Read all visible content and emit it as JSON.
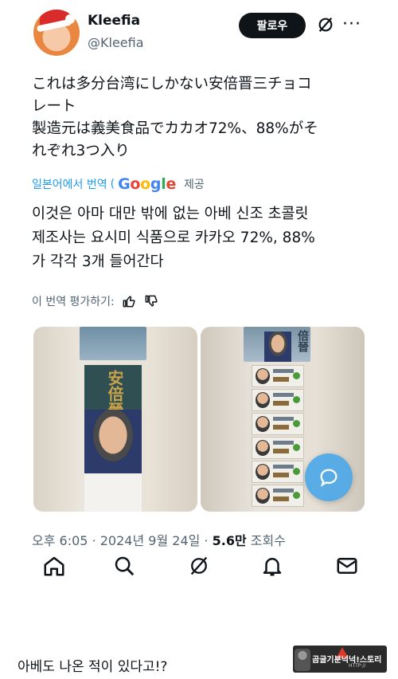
{
  "header": {
    "display_name": "Kleefia",
    "handle": "@Kleefia",
    "follow_label": "팔로우"
  },
  "post": {
    "original_lines": [
      "これは多分台湾にしかない安倍晋三チョコ",
      "レート",
      "製造元は義美食品でカカオ72%、88%がそ",
      "れぞれ3つ入り"
    ],
    "translate_label": "일본어에서 번역",
    "translate_provider": "Google",
    "translate_provide_suffix": "제공",
    "translated_lines": [
      "이것은 아마 대만 밖에 없는 아베 신조 초콜릿",
      "제조사는 요시미 식품으로 카카오 72%, 88%",
      "가 각각 3개 들어간다"
    ],
    "rate_label": "이 번역 평가하기:",
    "photo_left_text": "安倍晉三",
    "photo_right_text": "倍晉"
  },
  "meta": {
    "time": "오후 6:05",
    "date": "2024년 9월 24일",
    "views": "5.6만",
    "views_label": "조회수"
  },
  "caption": "아베도 나온 적이 있다고!?",
  "watermark": {
    "text": "곰굴기분넉넉!스토리",
    "sub": "HTTP://"
  },
  "colors": {
    "accent": "#1d9bf0",
    "fab": "#4ea8e8",
    "muted": "#536471"
  }
}
